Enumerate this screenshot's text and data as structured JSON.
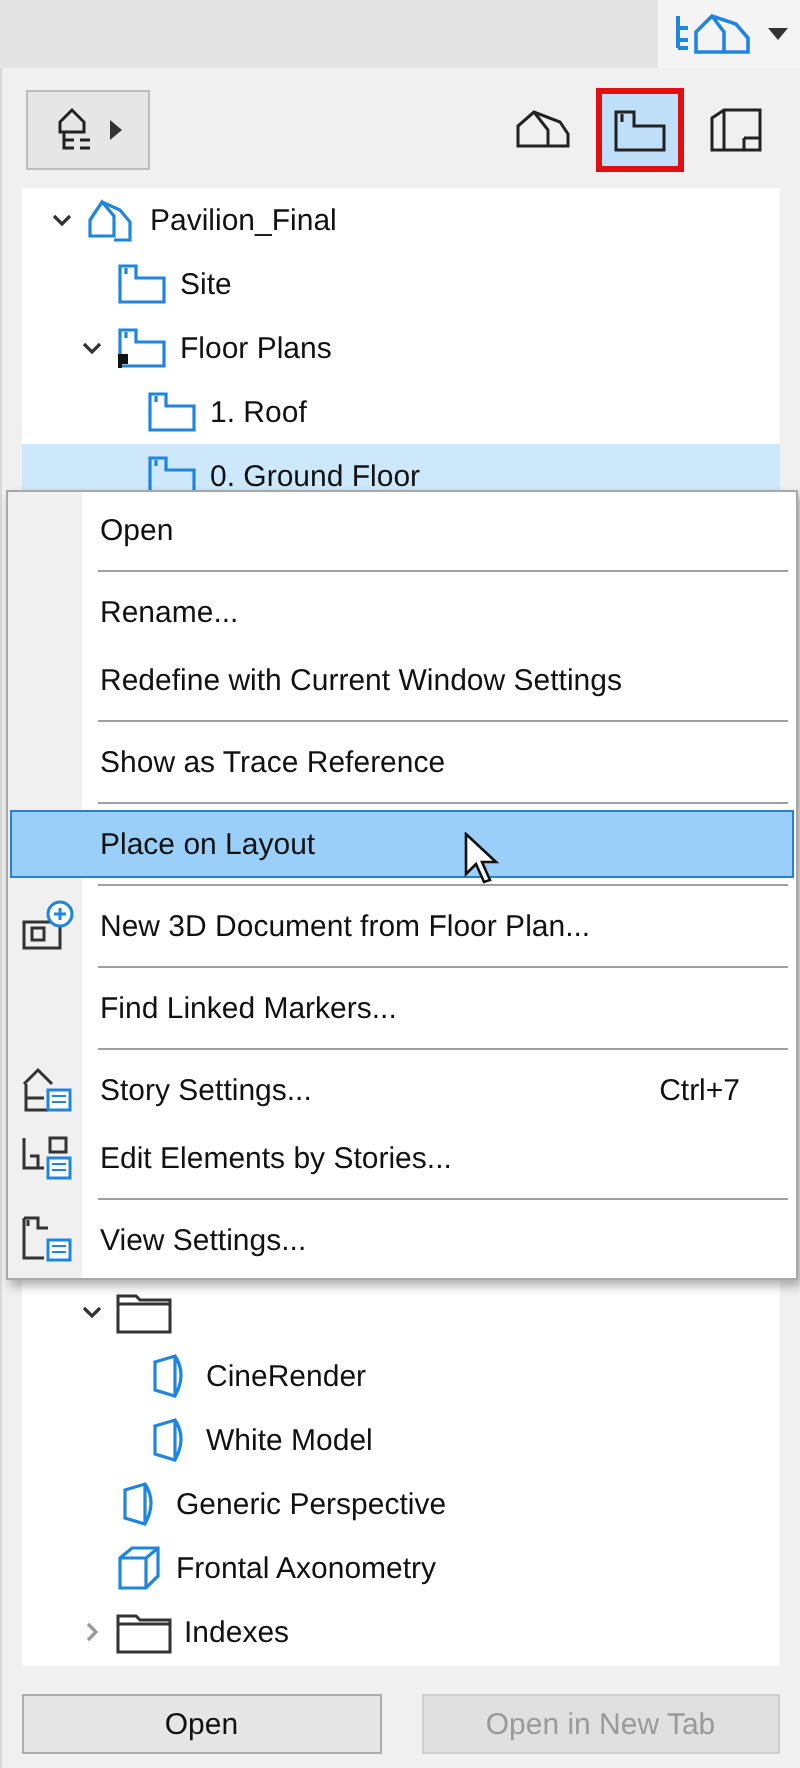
{
  "view_map_switch": {
    "selected": true
  },
  "navigator": {
    "modes": [
      {
        "selected": false
      },
      {
        "selected": true
      },
      {
        "selected": false
      }
    ],
    "tree": [
      {
        "label": "Pavilion_Final",
        "kind": "project",
        "expanded": true,
        "selected": false,
        "children": [
          {
            "label": "Site",
            "kind": "plan",
            "selected": false
          },
          {
            "label": "Floor Plans",
            "kind": "plan-set",
            "expanded": true,
            "selected": false,
            "children": [
              {
                "label": "1. Roof",
                "kind": "plan",
                "selected": false
              },
              {
                "label": "0. Ground Floor",
                "kind": "plan",
                "selected": true
              }
            ]
          },
          {
            "kind": "folder",
            "expanded": true,
            "selected": false,
            "children": [
              {
                "label": "CineRender",
                "kind": "camera",
                "selected": false
              },
              {
                "label": "White Model",
                "kind": "camera",
                "selected": false
              }
            ]
          },
          {
            "label": "Generic Perspective",
            "kind": "camera",
            "selected": false
          },
          {
            "label": "Frontal Axonometry",
            "kind": "cube",
            "selected": false
          },
          {
            "label": "Indexes",
            "kind": "folder",
            "expanded": false,
            "selected": false
          }
        ]
      }
    ],
    "buttons": [
      {
        "label": "Open",
        "disabled": false
      },
      {
        "label": "Open in New Tab",
        "disabled": true
      }
    ]
  },
  "context_menu": {
    "groups": [
      [
        {
          "label": "Open",
          "kind": "plain",
          "selected": false
        }
      ],
      [
        {
          "label": "Rename...",
          "kind": "plain",
          "selected": false
        },
        {
          "label": "Redefine with Current Window Settings",
          "kind": "plain",
          "selected": false
        }
      ],
      [
        {
          "label": "Show as Trace Reference",
          "kind": "plain",
          "selected": false
        }
      ],
      [
        {
          "label": "Place on Layout",
          "kind": "plain",
          "selected": true
        }
      ],
      [
        {
          "label": "New 3D Document from Floor Plan...",
          "kind": "new-document",
          "selected": false
        }
      ],
      [
        {
          "label": "Find Linked Markers...",
          "kind": "plain",
          "selected": false
        }
      ],
      [
        {
          "label": "Story Settings...",
          "kind": "story-settings",
          "shortcut": "Ctrl+7",
          "selected": false
        },
        {
          "label": "Edit Elements by Stories...",
          "kind": "stories-table",
          "selected": false
        }
      ],
      [
        {
          "label": "View Settings...",
          "kind": "view-settings",
          "selected": false
        }
      ]
    ]
  }
}
